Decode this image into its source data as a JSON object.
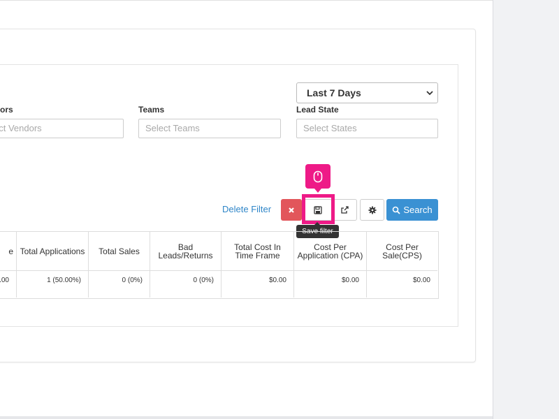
{
  "filters": {
    "date_range_value": "Last 7 Days",
    "vendors_label_partial": "ors",
    "vendors_placeholder_partial": "ect Vendors",
    "teams_label": "Teams",
    "teams_placeholder": "Select Teams",
    "lead_state_label": "Lead State",
    "lead_state_placeholder": "Select States"
  },
  "actions": {
    "delete_filter": "Delete Filter",
    "search": "Search",
    "save_tooltip": "Save filter"
  },
  "colors": {
    "clear": "#e2565b",
    "search": "#3a91d3",
    "highlight": "#ee1a87"
  },
  "table": {
    "headers": [
      "e",
      "Total Applications",
      "Total Sales",
      "Bad Leads/Returns",
      "Total Cost In Time Frame",
      "Cost Per Application (CPA)",
      "Cost Per Sale(CPS)"
    ],
    "row": [
      ".00",
      "1 (50.00%)",
      "0 (0%)",
      "0 (0%)",
      "$0.00",
      "$0.00",
      "$0.00"
    ]
  },
  "icons": {
    "clear": "times-icon",
    "save": "floppy-disk-icon",
    "export": "external-link-icon",
    "settings": "gear-icon",
    "search": "search-icon",
    "pointer": "mouse-icon"
  }
}
